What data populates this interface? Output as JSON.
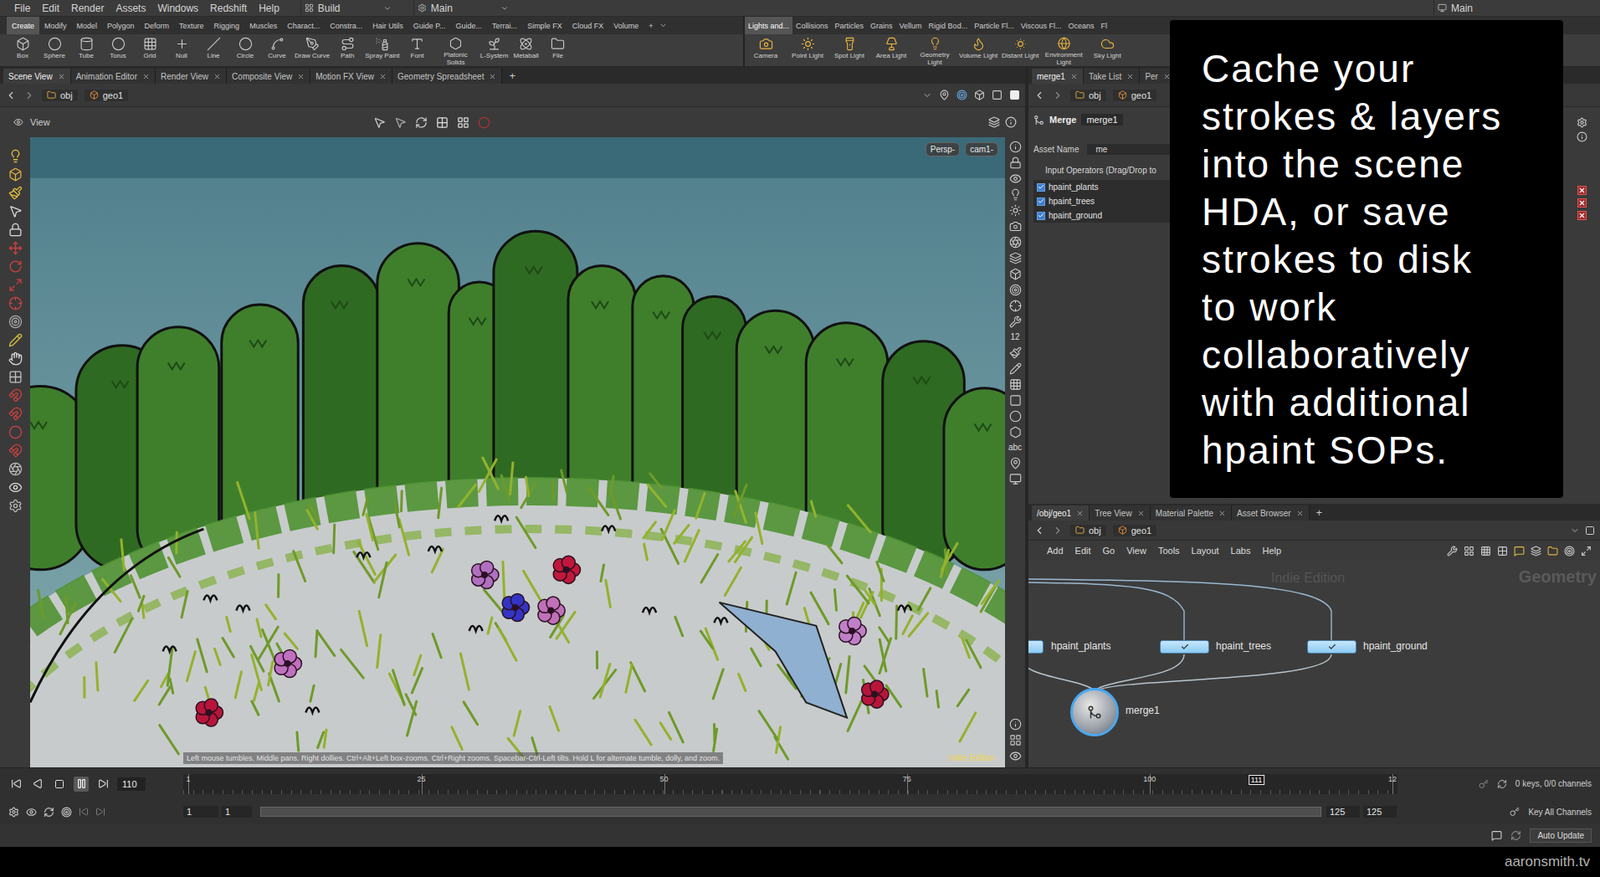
{
  "menubar": {
    "menus": [
      "File",
      "Edit",
      "Render",
      "Assets",
      "Windows",
      "Redshift",
      "Help"
    ],
    "desktop": "Build",
    "context": "Main",
    "right_context": "Main"
  },
  "shelf": {
    "tabs_left": [
      {
        "label": "Create",
        "selected": true
      },
      {
        "label": "Modify",
        "selected": false
      },
      {
        "label": "Model",
        "selected": false
      },
      {
        "label": "Polygon",
        "selected": false
      },
      {
        "label": "Deform",
        "selected": false
      },
      {
        "label": "Texture",
        "selected": false
      },
      {
        "label": "Rigging",
        "selected": false
      },
      {
        "label": "Muscles",
        "selected": false
      },
      {
        "label": "Charact...",
        "selected": false
      },
      {
        "label": "Constra...",
        "selected": false
      },
      {
        "label": "Hair Utils",
        "selected": false
      },
      {
        "label": "Guide P...",
        "selected": false
      },
      {
        "label": "Guide...",
        "selected": false
      },
      {
        "label": "Terrai...",
        "selected": false
      },
      {
        "label": "Simple FX",
        "selected": false
      },
      {
        "label": "Cloud FX",
        "selected": false
      },
      {
        "label": "Volume",
        "selected": false
      }
    ],
    "add": "+",
    "tabs_right": [
      {
        "label": "Lights and...",
        "selected": true
      },
      {
        "label": "Collisions",
        "selected": false
      },
      {
        "label": "Particles",
        "selected": false
      },
      {
        "label": "Grains",
        "selected": false
      },
      {
        "label": "Vellum",
        "selected": false
      },
      {
        "label": "Rigid Bod...",
        "selected": false
      },
      {
        "label": "Particle Fl...",
        "selected": false
      },
      {
        "label": "Viscous Fl...",
        "selected": false
      },
      {
        "label": "Oceans",
        "selected": false
      },
      {
        "label": "Fl",
        "selected": false
      }
    ],
    "tools_left": [
      "Box",
      "Sphere",
      "Tube",
      "Torus",
      "Grid",
      "Null",
      "Line",
      "Circle",
      "Curve",
      "Draw Curve",
      "Path",
      "Spray Paint",
      "Font",
      "Platonic Solids",
      "L-System",
      "Metaball",
      "File"
    ],
    "tools_right": [
      "Camera",
      "Point Light",
      "Spot Light",
      "Area Light",
      "Geometry Light",
      "Volume Light",
      "Distant Light",
      "Environment Light",
      "Sky Light"
    ]
  },
  "scene_pane": {
    "tabs": [
      {
        "label": "Scene View",
        "selected": true
      },
      {
        "label": "Animation Editor",
        "selected": false
      },
      {
        "label": "Render View",
        "selected": false
      },
      {
        "label": "Composite View",
        "selected": false
      },
      {
        "label": "Motion FX View",
        "selected": false
      },
      {
        "label": "Geometry Spreadsheet",
        "selected": false
      }
    ],
    "add": "+",
    "path": [
      "obj",
      "geo1"
    ],
    "view_label": "View",
    "camera_buttons": [
      "Persp-",
      "cam1-"
    ],
    "side_labels": [
      "12",
      "abc"
    ],
    "help_text": "Left mouse tumbles. Middle pans. Right dollies. Ctrl+Alt+Left box-zooms. Ctrl+Right zooms. Spacebar-Ctrl-Left tilts. Hold L for alternate tumble, dolly, and zoom.",
    "edition": "Indie Edition"
  },
  "parameter_pane": {
    "tabs": [
      {
        "label": "merge1",
        "selected": true
      },
      {
        "label": "Take List",
        "selected": false
      },
      {
        "label": "Per",
        "selected": false
      }
    ],
    "path": [
      "obj",
      "geo1"
    ],
    "node_type": "Merge",
    "node_name": "merge1",
    "asset_label": "Asset Name",
    "asset_value": "me",
    "inputs_label": "Input Operators (Drag/Drop to",
    "inputs": [
      {
        "name": "hpaint_plants",
        "checked": true
      },
      {
        "name": "hpaint_trees",
        "checked": true
      },
      {
        "name": "hpaint_ground",
        "checked": true
      }
    ]
  },
  "caption": {
    "lines": [
      "Cache your",
      "strokes & layers",
      "into the scene",
      "HDA, or save",
      "strokes to disk",
      "to work",
      "collaboratively",
      "with additional",
      "hpaint SOPs."
    ]
  },
  "network_pane": {
    "tabs": [
      {
        "label": "/obj/geo1",
        "selected": true
      },
      {
        "label": "Tree View",
        "selected": false
      },
      {
        "label": "Material Palette",
        "selected": false
      },
      {
        "label": "Asset Browser",
        "selected": false
      }
    ],
    "add": "+",
    "path": [
      "obj",
      "geo1"
    ],
    "menus": [
      "Add",
      "Edit",
      "Go",
      "View",
      "Tools",
      "Layout",
      "Labs",
      "Help"
    ],
    "watermark": "Indie Edition",
    "context": "Geometry",
    "nodes": [
      {
        "name": "hpaint_plants",
        "kind": "sop",
        "displayed": false
      },
      {
        "name": "hpaint_trees",
        "kind": "sop",
        "displayed": false
      },
      {
        "name": "hpaint_ground",
        "kind": "sop",
        "displayed": false
      },
      {
        "name": "merge1",
        "kind": "merge",
        "displayed": true
      }
    ]
  },
  "timeline": {
    "current_frame": "110",
    "playing": true,
    "start": 1,
    "end": 125,
    "ticks": [
      {
        "label": "1",
        "frame": 1
      },
      {
        "label": "25",
        "frame": 25
      },
      {
        "label": "50",
        "frame": 50
      },
      {
        "label": "75",
        "frame": 75
      },
      {
        "label": "100",
        "frame": 100
      },
      {
        "label": "12",
        "frame": 125
      }
    ],
    "marker": {
      "label": "111",
      "frame": 111
    },
    "keys_info": "0 keys, 0/0 channels"
  },
  "range": {
    "start": "1",
    "current_start": "1",
    "current_end": "125",
    "end": "125",
    "level": 1
  },
  "key_button": "Key All Channels",
  "status": {
    "update_mode": "Auto Update"
  },
  "watermark": "aaronsmith.tv"
}
